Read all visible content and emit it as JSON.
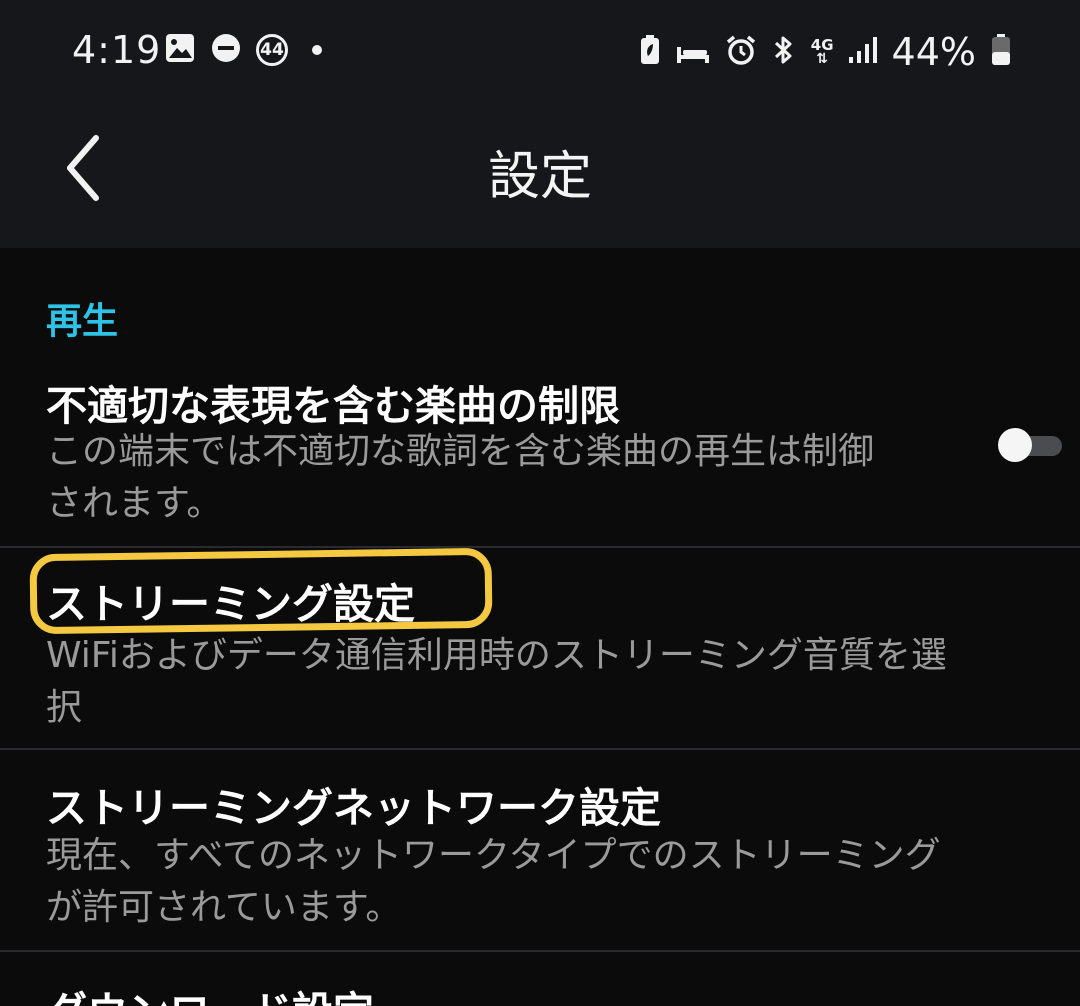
{
  "status_bar": {
    "time": "4:19",
    "notification_count": "44",
    "battery_percent": "44%",
    "network_label": "4G",
    "left_icons": [
      "gallery-icon",
      "dnd-icon",
      "notification-count-badge",
      "more-notifications-dot"
    ],
    "right_icons": [
      "battery-saver-icon",
      "sleep-mode-icon",
      "alarm-icon",
      "bluetooth-icon",
      "network-4g-icon",
      "signal-icon",
      "battery-icon"
    ]
  },
  "app_bar": {
    "title": "設定",
    "back_icon": "chevron-left-icon"
  },
  "section": {
    "header": "再生",
    "header_color": "#2ec4e8"
  },
  "items": [
    {
      "title": "不適切な表現を含む楽曲の制限",
      "subtitle_line1": "この端末では不適切な歌詞を含む楽曲の再生は制御",
      "subtitle_line2": "されます。",
      "toggle_on": false
    },
    {
      "title": "ストリーミング設定",
      "subtitle_line1": "WiFiおよびデータ通信利用時のストリーミング音質を選",
      "subtitle_line2": "択",
      "highlighted": true,
      "highlight_color": "#f5c842"
    },
    {
      "title": "ストリーミングネットワーク設定",
      "subtitle_line1": "現在、すべてのネットワークタイプでのストリーミング",
      "subtitle_line2": "が許可されています。"
    },
    {
      "title": "ダウンロード設定"
    }
  ],
  "colors": {
    "background": "#0b0b0c",
    "app_bar": "#16171b",
    "subtitle": "#9a9a9a",
    "divider": "#2a2b2f"
  }
}
